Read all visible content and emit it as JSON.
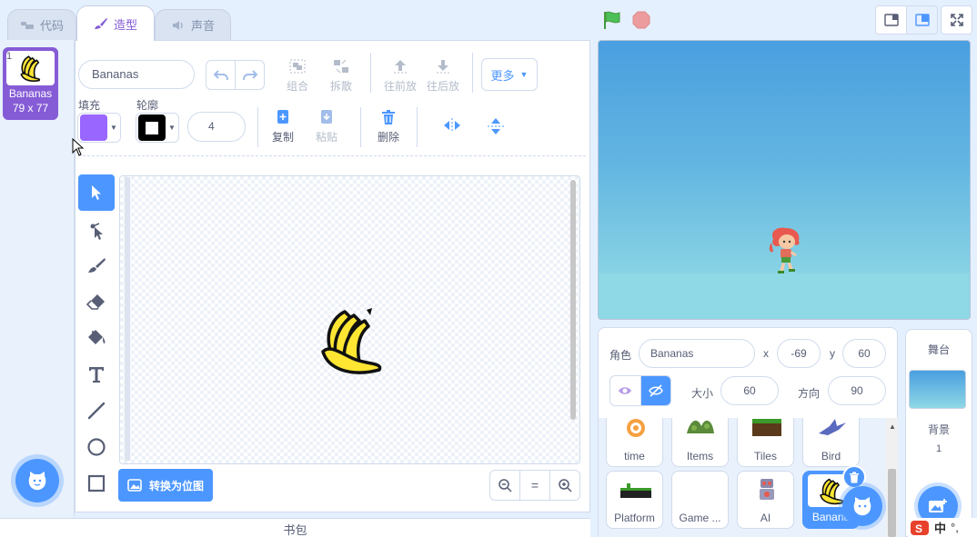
{
  "tabs": [
    {
      "label": "代码",
      "icon": "code-icon"
    },
    {
      "label": "造型",
      "icon": "brush-icon"
    },
    {
      "label": "声音",
      "icon": "speaker-icon"
    }
  ],
  "costumes": [
    {
      "number": "1",
      "name": "Bananas",
      "size": "79 x 77"
    }
  ],
  "editor": {
    "costume_name": "Bananas",
    "group_label": "组合",
    "ungroup_label": "拆散",
    "forward_label": "往前放",
    "backward_label": "往后放",
    "more_label": "更多",
    "fill_label": "填充",
    "outline_label": "轮廓",
    "outline_width": "4",
    "copy_label": "复制",
    "paste_label": "粘贴",
    "delete_label": "删除",
    "convert_bitmap_label": "转换为位图",
    "zoom_reset_label": "="
  },
  "colors": {
    "fill": "#9966ff",
    "outline": "#000000",
    "accent": "#4c97ff",
    "tab_active": "#855cd6",
    "flag": "#4cbf56",
    "stop": "#ec9c9c"
  },
  "backpack_label": "书包",
  "sprite_info": {
    "sprite_label": "角色",
    "sprite_name": "Bananas",
    "x_label": "x",
    "x_value": "-69",
    "y_label": "y",
    "y_value": "60",
    "size_label": "大小",
    "size_value": "60",
    "direction_label": "方向",
    "direction_value": "90"
  },
  "sprites": [
    {
      "name": "time"
    },
    {
      "name": "Items"
    },
    {
      "name": "Tiles"
    },
    {
      "name": "Bird"
    },
    {
      "name": "Platform"
    },
    {
      "name": "Game ..."
    },
    {
      "name": "AI"
    },
    {
      "name": "Banana"
    }
  ],
  "stage_pane": {
    "title": "舞台",
    "backdrops_label": "背景",
    "backdrop_count": "1"
  },
  "ime": {
    "mode": "中",
    "punct": "°,"
  }
}
